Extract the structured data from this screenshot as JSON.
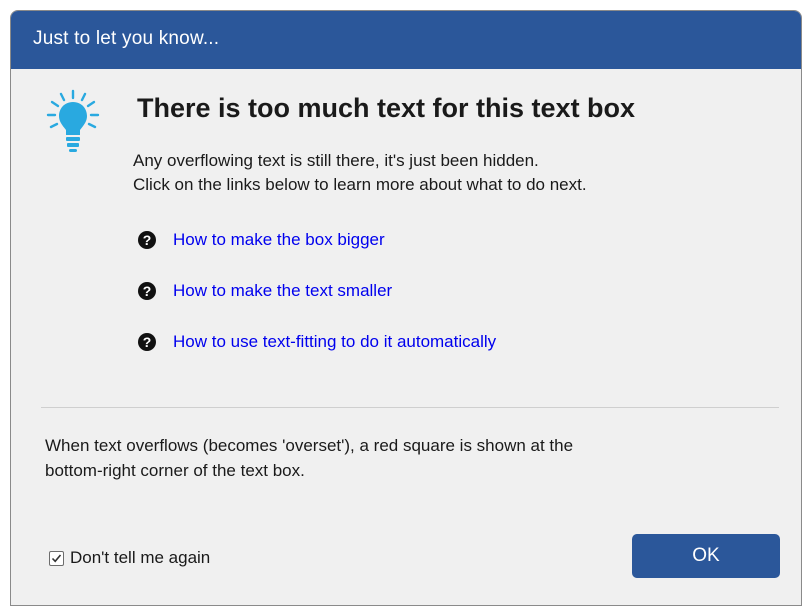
{
  "window": {
    "title": "Just to let you know..."
  },
  "message": {
    "icon": "lightbulb-icon",
    "heading": "There is too much text for this text box",
    "description_lines": [
      "Any overflowing text is still there, it's just been hidden.",
      "Click on the links below to learn more about what to do next."
    ]
  },
  "links": [
    {
      "icon": "question-icon",
      "label": "How to make the box bigger"
    },
    {
      "icon": "question-icon",
      "label": "How to make the text smaller"
    },
    {
      "icon": "question-icon",
      "label": "How to use text-fitting to do it automatically"
    }
  ],
  "note_lines": [
    "When text overflows (becomes 'overset'), a red square is shown at the",
    "bottom-right corner of the text box."
  ],
  "footer": {
    "checkbox_label": "Don't tell me again",
    "checkbox_checked": true,
    "ok_label": "OK"
  },
  "colors": {
    "title_bar": "#2b579a",
    "link": "#0000ee",
    "bulb": "#29a9e0",
    "dialog_background": "#f0f0f0"
  }
}
